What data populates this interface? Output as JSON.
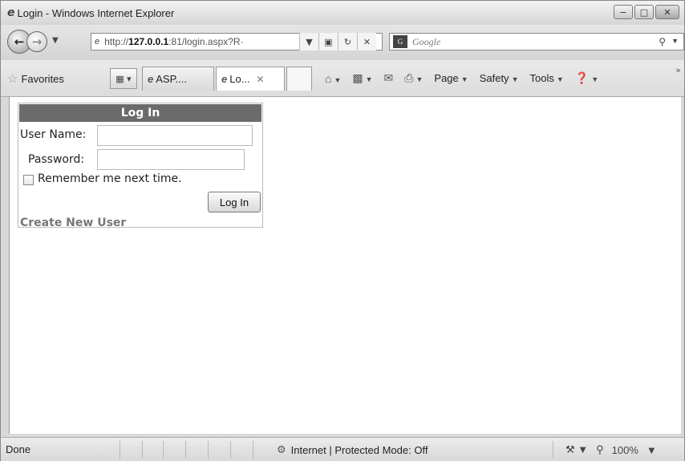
{
  "window": {
    "title": "Login - Windows Internet Explorer"
  },
  "address": {
    "url_prefix": "http://",
    "url_host": "127.0.0.1",
    "url_rest": ":81/login.aspx?R·"
  },
  "search": {
    "placeholder": "Google"
  },
  "toolbar": {
    "favorites_label": "Favorites",
    "tabs": [
      {
        "label": "ASP...."
      },
      {
        "label": "Lo..."
      }
    ],
    "commands": {
      "page_label": "Page",
      "safety_label": "Safety",
      "tools_label": "Tools"
    }
  },
  "login": {
    "header": "Log In",
    "username_label": "User Name:",
    "username_value": "",
    "password_label": "Password:",
    "password_value": "",
    "remember_label": "Remember me next time.",
    "remember_checked": false,
    "submit_label": "Log In",
    "create_user_link": "Create New User"
  },
  "status": {
    "text": "Done",
    "zone": "Internet | Protected Mode: Off",
    "zoom": "100%"
  },
  "icons": [
    "ie-icon",
    "back-icon",
    "forward-icon",
    "refresh-icon",
    "stop-icon",
    "rss-icon",
    "home-icon",
    "feeds-icon",
    "mail-icon",
    "print-icon",
    "help-icon",
    "search-icon",
    "globe-icon",
    "zoom-icon",
    "favorites-star-icon"
  ]
}
